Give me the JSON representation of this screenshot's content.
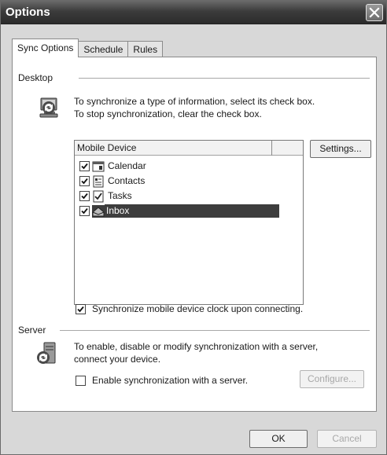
{
  "window": {
    "title": "Options",
    "close_icon": "close-icon"
  },
  "tabs": [
    {
      "label": "Sync Options",
      "active": true
    },
    {
      "label": "Schedule",
      "active": false
    },
    {
      "label": "Rules",
      "active": false
    }
  ],
  "desktop": {
    "group_label": "Desktop",
    "icon": "desktop-sync-icon",
    "line1": "To synchronize a type of information, select its check box.",
    "line2": "To stop synchronization, clear the check box.",
    "list_header": "Mobile Device",
    "settings_button": "Settings...",
    "items": [
      {
        "label": "Calendar",
        "checked": true,
        "icon": "calendar-icon",
        "selected": false
      },
      {
        "label": "Contacts",
        "checked": true,
        "icon": "contacts-icon",
        "selected": false
      },
      {
        "label": "Tasks",
        "checked": true,
        "icon": "tasks-icon",
        "selected": false
      },
      {
        "label": "Inbox",
        "checked": true,
        "icon": "inbox-icon",
        "selected": true
      }
    ],
    "clock_sync_label": "Synchronize mobile device clock upon connecting.",
    "clock_sync_checked": true
  },
  "server": {
    "group_label": "Server",
    "icon": "server-sync-icon",
    "line1": "To enable, disable or modify synchronization with a server,",
    "line2": "connect your device.",
    "enable_label": "Enable synchronization with a server.",
    "enable_checked": false,
    "configure_button": "Configure..."
  },
  "footer": {
    "ok_button": "OK",
    "cancel_button": "Cancel"
  }
}
